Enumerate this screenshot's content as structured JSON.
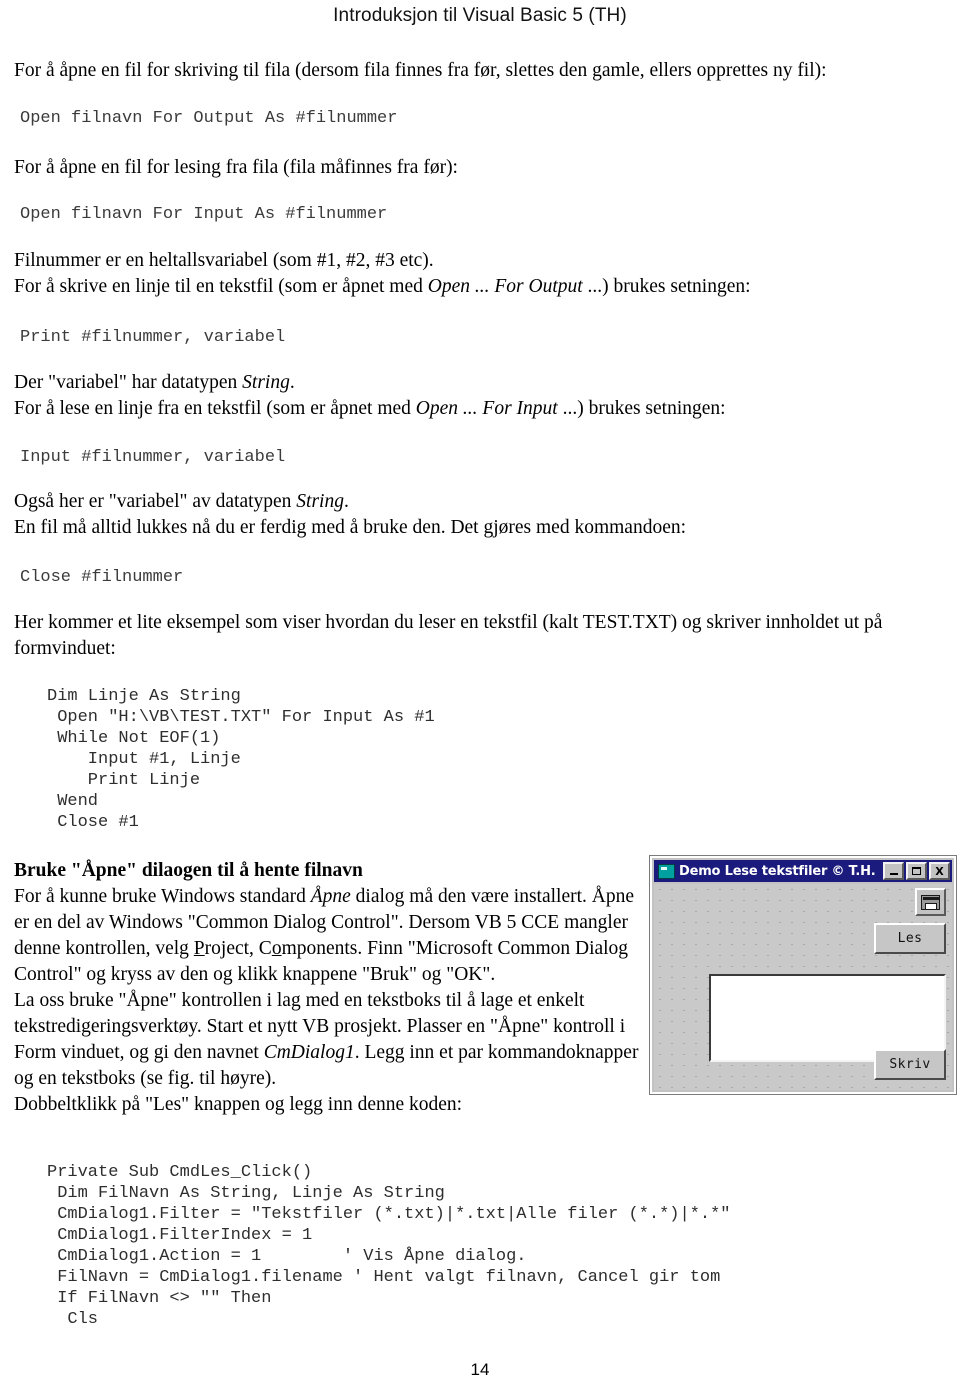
{
  "header": {
    "title": "Introduksjon til Visual Basic 5 (TH)"
  },
  "footer": {
    "page_number": "14"
  },
  "body": {
    "p1": "For å åpne en fil for skriving til fila (dersom fila finnes fra  før, slettes den gamle, ellers opprettes ny fil):",
    "code1": "Open filnavn For Output As #filnummer",
    "p2": "For å åpne en fil for lesing fra fila (fila måfinnes  fra før):",
    "code2": "Open filnavn For Input As #filnummer",
    "p3": "Filnummer er en heltallsvariabel (som #1, #2, #3 etc).",
    "p4_a": "For å skrive en linje til en tekstfil (som er åpnet med  ",
    "p4_i1": "Open",
    "p4_b": " ... ",
    "p4_i2": "For Output",
    "p4_c": " ...) brukes setningen:",
    "code3": "Print #filnummer, variabel",
    "p5_a": "Der \"variabel\" har datatypen ",
    "p5_i": "String",
    "p5_b": ".",
    "p6_a": "For å lese en linje fra en tekstfil (som er åpnet med  ",
    "p6_i1": "Open",
    "p6_b": " ... ",
    "p6_i2": "For Input",
    "p6_c": " ...) brukes setningen:",
    "code4": "Input #filnummer, variabel",
    "p7_a": "Også her er \"variabel\" av datatypen ",
    "p7_i": "String",
    "p7_b": ".",
    "p8": "En fil må alltid lukkes nå du er ferdig med å bruke den.  Det gjøres med kommandoen:",
    "code5": "Close #filnummer",
    "p9": "   Her kommer et lite eksempel som viser hvordan du leser en tekstfil (kalt TEST.TXT)  og skriver innholdet ut på formvinduet:",
    "code_example": "Dim Linje As String\n Open \"H:\\VB\\TEST.TXT\" For Input As #1\n While Not EOF(1)\n    Input #1, Linje\n    Print Linje\n Wend\n Close #1",
    "heading1": "Bruke \"Åpne\" dilaogen til å hente filnavn",
    "p10_a": "   For å kunne bruke Windows standard ",
    "p10_i": "Åpne",
    "p10_b": " dialog må den  være installert.  Åpne er en del av Windows \"Common Dialog  Control\". Dersom VB 5 CCE mangler denne kontrollen, velg ",
    "p10_u1_pre": "",
    "p10_u1": "P",
    "p10_u1_post": "roject,  C",
    "p10_u2": "o",
    "p10_u2_post": "mponents.  Finn \"Microsoft Common Dialog Control\" og kryss av  den og klikk knappene \"Bruk\" og \"OK\".",
    "p11_a": "   La oss bruke \"Åpne\" kontrollen i lag med en tekstboks til å  lage et enkelt tekstredigeringsverktøy. Start et nytt VB prosjekt.  Plasser en \"Åpne\" kontroll i Form vinduet, og gi den navnet  ",
    "p11_i": "CmDialog1",
    "p11_b": ". Legg inn et par kommandoknapper og en tekstboks (se fig.  til høyre).",
    "p12": "   Dobbeltklikk på \"Les\" knappen og legg inn denne koden:",
    "code_final": "Private Sub CmdLes_Click()\n Dim FilNavn As String, Linje As String\n CmDialog1.Filter = \"Tekstfiler (*.txt)|*.txt|Alle filer (*.*)|*.*\"\n CmDialog1.FilterIndex = 1\n CmDialog1.Action = 1        ' Vis Åpne dialog.\n FilNavn = CmDialog1.filename ' Hent valgt filnavn, Cancel gir tom\n If FilNavn <> \"\" Then\n  Cls"
  },
  "vbform": {
    "title": "Demo Lese tekstfiler © T.H.",
    "minimize_label": "_",
    "maximize_label": "□",
    "close_label": "X",
    "button_les": "Les",
    "button_skriv": "Skriv",
    "textbox_value": "",
    "titlebar_color": "#1b1b7d",
    "face_color": "#c3c3c3"
  }
}
